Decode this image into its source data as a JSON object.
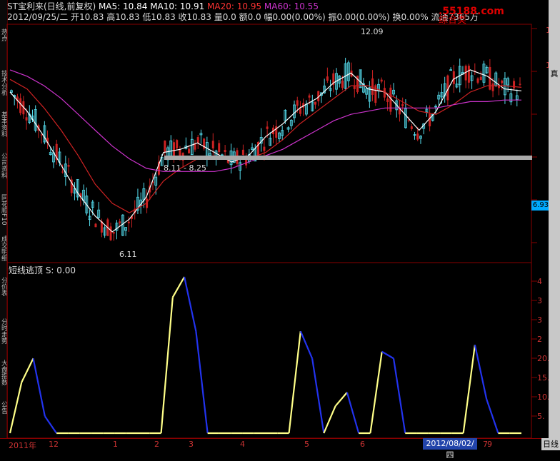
{
  "header": {
    "line1": [
      {
        "text": "ST宝利来(日线,前复权)",
        "color": "#dddddd"
      },
      {
        "text": "MA5: 10.84",
        "color": "#ffffff"
      },
      {
        "text": "MA10: 10.91",
        "color": "#ffffff"
      },
      {
        "text": "MA20: 10.95",
        "color": "#ff3333"
      },
      {
        "text": "MA60: 10.55",
        "color": "#cc33cc"
      }
    ],
    "line2": "2012/09/25/二 开10.83 高10.83 低10.83 收10.83 量0.0 额0.0 幅0.00(0.00%) 振0.00(0.00%) 换0.00% 流通7365万"
  },
  "watermark": {
    "site": ".55188.com",
    "label": "综合类"
  },
  "annotations": {
    "high": "12.09",
    "low": "6.11",
    "range": "8.11 - 8.25",
    "price_box": "6.93"
  },
  "indicator": {
    "title": "短线逃顶 S: 0.00"
  },
  "right_axis_top": [
    "1",
    "1"
  ],
  "right_axis_bottom": [
    "4",
    "3",
    "3",
    "2",
    "20.",
    "15.",
    "10.",
    "5."
  ],
  "x_labels": [
    {
      "text": "2011年"
    },
    {
      "text": "12"
    },
    {
      "text": "1"
    },
    {
      "text": "2"
    },
    {
      "text": "3"
    },
    {
      "text": "4"
    },
    {
      "text": "5"
    },
    {
      "text": "6"
    },
    {
      "text": "7"
    },
    {
      "text": "8"
    },
    {
      "text": "9"
    }
  ],
  "x_selected": "2012/08/02/四",
  "bottom_right": "日线",
  "right_panel_tab": "真",
  "side_labels": [
    "热点",
    "技术分析",
    "基本资料",
    "公司资料",
    "同花顺F10",
    "成交明细",
    "分价表",
    "分时走势",
    "大盘指数",
    "公告"
  ],
  "colors": {
    "up": "#55ddee",
    "down": "#cc2222",
    "ma5": "#ffffff",
    "ma10": "#ffffff",
    "ma20": "#cc2222",
    "ma60": "#cc33cc",
    "ind_up": "#ffff88",
    "ind_down": "#2233ee"
  },
  "chart_data": {
    "type": "line",
    "title": "",
    "note": "Candlestick price chart with moving averages; values approximate",
    "series": [
      {
        "name": "MA5",
        "values": [
          10.8,
          10.2,
          9.4,
          8.5,
          7.6,
          6.9,
          6.4,
          6.8,
          7.5,
          8.9,
          9.0,
          9.2,
          8.9,
          8.6,
          8.8,
          9.4,
          9.8,
          10.3,
          10.6,
          11.1,
          11.4,
          10.9,
          10.8,
          10.2,
          9.6,
          10.2,
          11.2,
          11.5,
          11.3,
          10.9,
          10.84
        ]
      },
      {
        "name": "MA20",
        "values": [
          11.2,
          10.9,
          10.3,
          9.6,
          8.8,
          7.9,
          7.3,
          7.0,
          7.3,
          8.0,
          8.4,
          8.7,
          8.8,
          8.7,
          8.7,
          8.9,
          9.3,
          9.8,
          10.2,
          10.6,
          11.0,
          11.0,
          10.8,
          10.5,
          10.2,
          10.1,
          10.4,
          10.8,
          11.0,
          11.0,
          10.95
        ]
      },
      {
        "name": "MA60",
        "values": [
          11.5,
          11.3,
          11.0,
          10.6,
          10.1,
          9.6,
          9.1,
          8.7,
          8.4,
          8.3,
          8.3,
          8.3,
          8.3,
          8.4,
          8.6,
          8.8,
          9.0,
          9.3,
          9.6,
          9.9,
          10.1,
          10.2,
          10.3,
          10.3,
          10.3,
          10.3,
          10.4,
          10.5,
          10.5,
          10.55,
          10.55
        ]
      }
    ],
    "indicator_series": {
      "name": "短线逃顶",
      "values": [
        0,
        15,
        22,
        5,
        0,
        0,
        0,
        0,
        0,
        0,
        0,
        0,
        0,
        0,
        40,
        46,
        30,
        0,
        0,
        0,
        0,
        0,
        0,
        0,
        0,
        30,
        22,
        0,
        8,
        12,
        0,
        0,
        24,
        22,
        0,
        0,
        0,
        0,
        0,
        0,
        26,
        10,
        0,
        0,
        0
      ]
    }
  }
}
